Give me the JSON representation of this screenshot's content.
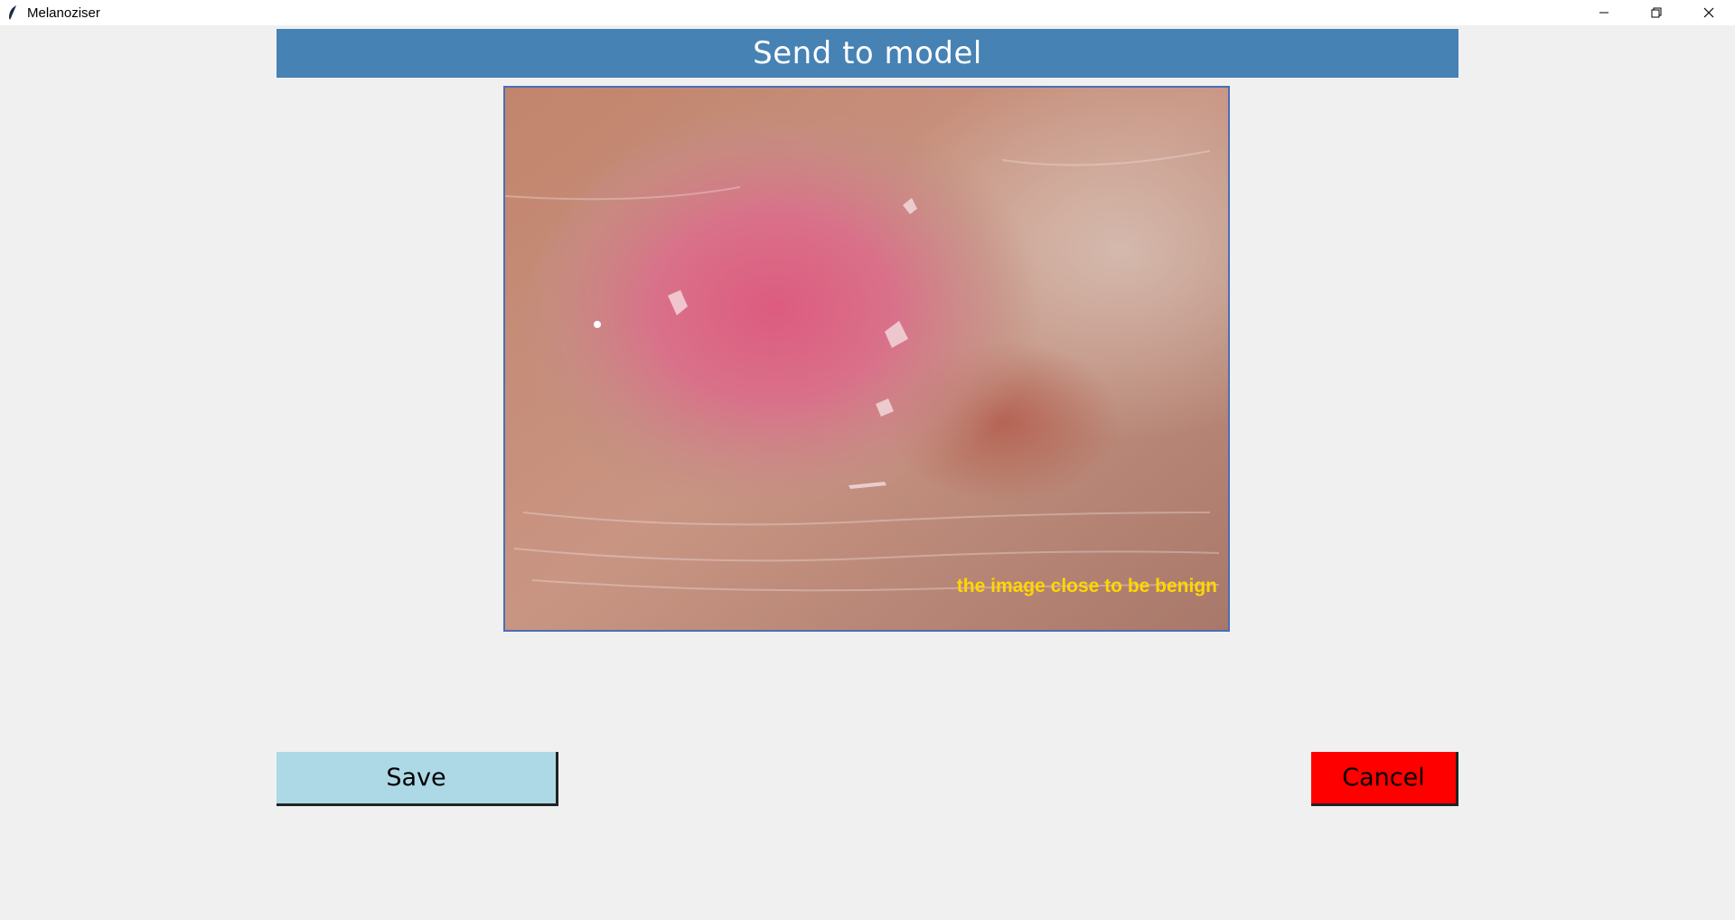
{
  "window": {
    "title": "Melanoziser",
    "icon": "feather-icon",
    "controls": [
      "minimize-icon",
      "restore-icon",
      "close-icon"
    ]
  },
  "header": {
    "title": "Send to model",
    "background": "#4682b4"
  },
  "image_panel": {
    "overlay_text": "the image close to be benign",
    "overlay_color": "#ffd700"
  },
  "actions": {
    "save_label": "Save",
    "save_color": "#add8e6",
    "cancel_label": "Cancel",
    "cancel_color": "#ff0000"
  }
}
